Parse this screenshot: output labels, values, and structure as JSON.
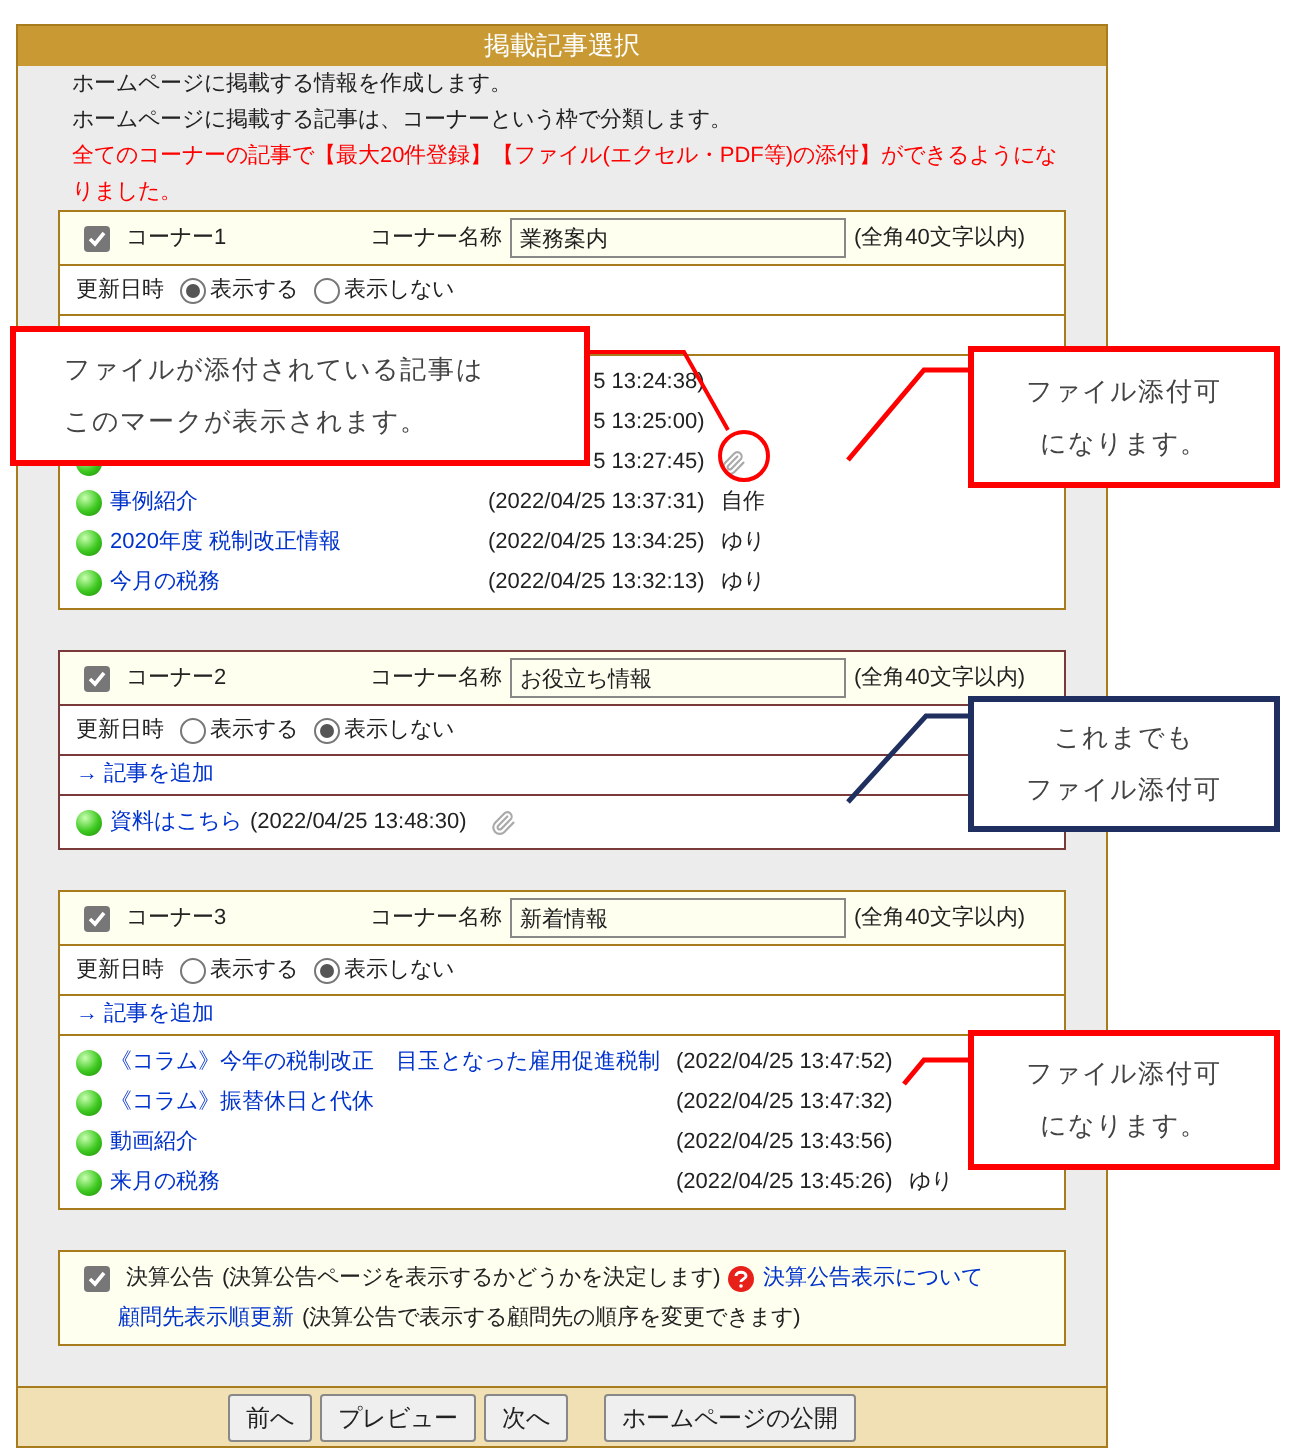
{
  "window": {
    "title": "掲載記事選択"
  },
  "intro": [
    "ホームページに掲載する情報を作成します。",
    "ホームページに掲載する記事は、コーナーという枠で分類します。"
  ],
  "notice": "全てのコーナーの記事で【最大20件登録】【ファイル(エクセル・PDF等)の添付】ができるようになりました。",
  "corners": [
    {
      "label": "コーナー1",
      "checked": true,
      "name_label": "コーナー名称",
      "name_value": "業務案内",
      "limit_note": "(全角40文字以内)",
      "date_label": "更新日時",
      "date_options": [
        {
          "label": "表示する",
          "selected": true
        },
        {
          "label": "表示しない",
          "selected": false
        }
      ],
      "dates_aligned": true,
      "articles": [
        {
          "date": "5 13:24:38)",
          "attachment": false
        },
        {
          "date": "5 13:25:00)",
          "attachment": false
        },
        {
          "date": "5 13:27:45)",
          "attachment": true
        },
        {
          "title": "事例紹介",
          "date": "(2022/04/25 13:37:31)",
          "author": "自作",
          "attachment": false
        },
        {
          "title": "2020年度 税制改正情報",
          "date": "(2022/04/25 13:34:25)",
          "author": "ゆり",
          "attachment": false
        },
        {
          "title": "今月の税務",
          "date": "(2022/04/25 13:32:13)",
          "author": "ゆり",
          "attachment": false
        }
      ]
    },
    {
      "label": "コーナー2",
      "checked": true,
      "name_label": "コーナー名称",
      "name_value": "お役立ち情報",
      "limit_note": "(全角40文字以内)",
      "date_label": "更新日時",
      "date_options": [
        {
          "label": "表示する",
          "selected": false
        },
        {
          "label": "表示しない",
          "selected": true
        }
      ],
      "add_link": "→ 記事を追加",
      "dates_aligned": false,
      "articles": [
        {
          "title": "資料はこちら",
          "date": "(2022/04/25 13:48:30)",
          "attachment": true
        }
      ]
    },
    {
      "label": "コーナー3",
      "checked": true,
      "name_label": "コーナー名称",
      "name_value": "新着情報",
      "limit_note": "(全角40文字以内)",
      "date_label": "更新日時",
      "date_options": [
        {
          "label": "表示する",
          "selected": false
        },
        {
          "label": "表示しない",
          "selected": true
        }
      ],
      "add_link": "→ 記事を追加",
      "dates_aligned": true,
      "articles": [
        {
          "title": "《コラム》今年の税制改正　目玉となった雇用促進税制",
          "date": "(2022/04/25 13:47:52)",
          "attachment": false
        },
        {
          "title": "《コラム》振替休日と代休",
          "date": "(2022/04/25 13:47:32)",
          "attachment": false
        },
        {
          "title": "動画紹介",
          "date": "(2022/04/25 13:43:56)",
          "attachment": false
        },
        {
          "title": "来月の税務",
          "date": "(2022/04/25 13:45:26)",
          "author": "ゆり",
          "attachment": false
        }
      ]
    }
  ],
  "settlement": {
    "checked": true,
    "label": "決算公告",
    "description": "(決算公告ページを表示するかどうかを決定します)",
    "help_link": "決算公告表示について",
    "order_link": "顧問先表示順更新",
    "order_description": "(決算公告で表示する顧問先の順序を変更できます)"
  },
  "buttons": [
    "前へ",
    "プレビュー",
    "次へ",
    "ホームページの公開"
  ],
  "callouts": [
    {
      "lines": [
        "ファイルが添付されている記事は",
        "このマークが表示されます。"
      ],
      "color": "#ff0000"
    },
    {
      "lines": [
        "ファイル添付可",
        "になります。"
      ],
      "color": "#ff0000"
    },
    {
      "lines": [
        "これまでも",
        "ファイル添付可"
      ],
      "color": "#1f2f5f"
    },
    {
      "lines": [
        "ファイル添付可",
        "になります。"
      ],
      "color": "#ff0000"
    }
  ]
}
